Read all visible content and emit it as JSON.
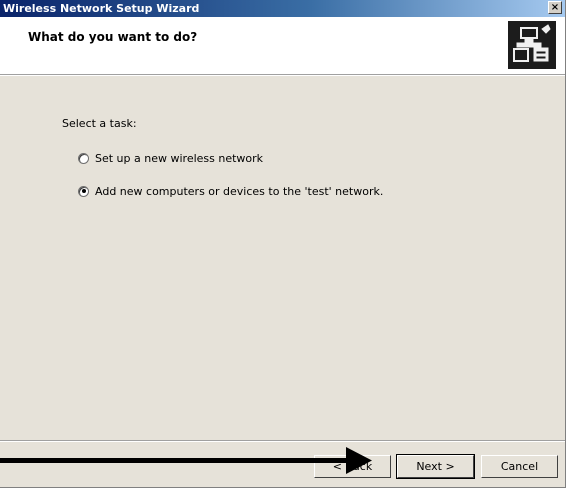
{
  "window": {
    "title": "Wireless Network Setup Wizard",
    "close_label": "×"
  },
  "header": {
    "title": "What do you want to do?",
    "icon": "network-computers-icon"
  },
  "task": {
    "label": "Select a task:",
    "options": [
      {
        "label": "Set up a new wireless network",
        "checked": false
      },
      {
        "label": "Add new computers or devices to the 'test' network.",
        "checked": true
      }
    ]
  },
  "buttons": {
    "back": "< Back",
    "next": "Next >",
    "cancel": "Cancel"
  }
}
